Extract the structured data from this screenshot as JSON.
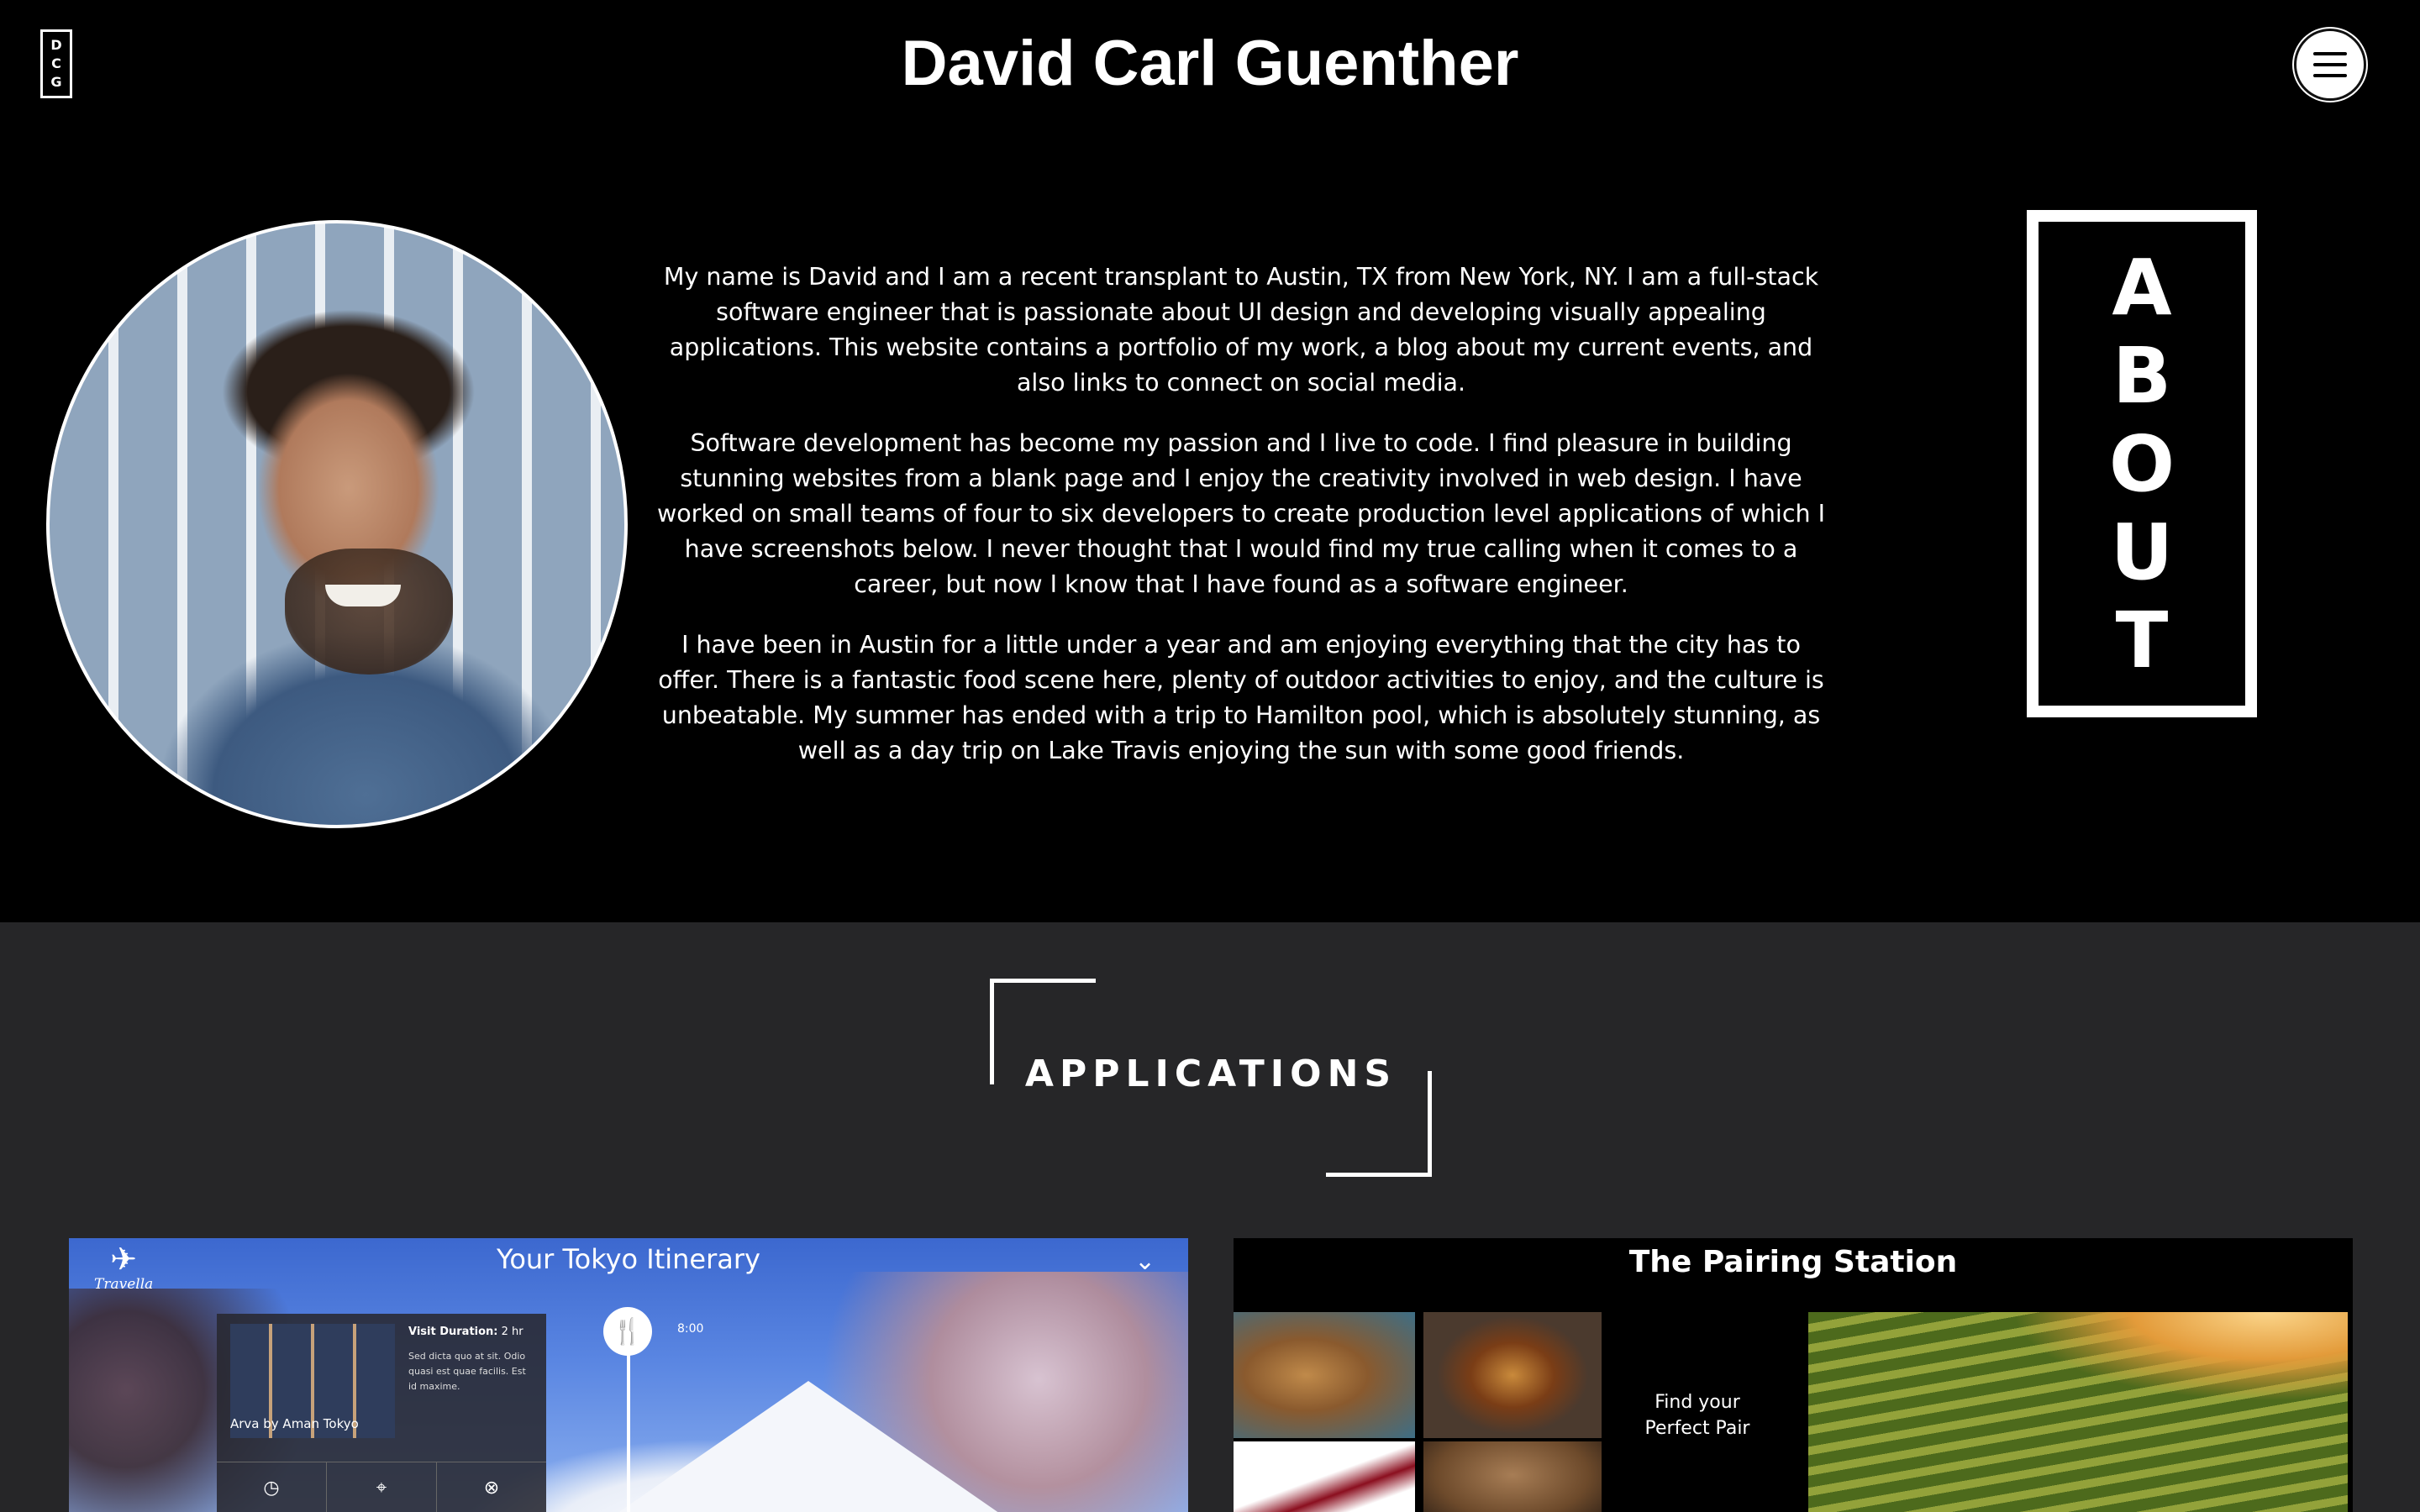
{
  "header": {
    "logo_letters": [
      "D",
      "C",
      "G"
    ],
    "title": "David Carl Guenther",
    "menu_icon": "hamburger-menu-icon"
  },
  "about": {
    "portrait_alt": "",
    "paragraphs": [
      "My name is David and I am a recent transplant to Austin, TX from New York, NY. I am a full-stack software engineer that is passionate about UI design and developing visually appealing applications. This website contains a portfolio of my work, a blog about my current events, and also links to connect on social media.",
      "Software development has become my passion and I live to code. I find pleasure in building stunning websites from a blank page and I enjoy the creativity involved in web design. I have worked on small teams of four to six developers to create production level applications of which I have screenshots below. I never thought that I would find my true calling when it comes to a career, but now I know that I have found as a software engineer.",
      "I have been in Austin for a little under a year and am enjoying everything that the city has to offer. There is a fantastic food scene here, plenty of outdoor activities to enjoy, and the culture is unbeatable. My summer has ended with a trip to Hamilton pool, which is absolutely stunning, as well as a day trip on Lake Travis enjoying the sun with some good friends."
    ],
    "badge_letters": [
      "A",
      "B",
      "O",
      "U",
      "T"
    ]
  },
  "applications": {
    "heading": "APPLICATIONS",
    "tokyo_card": {
      "brand": "Travella",
      "title": "Your Tokyo Itinerary",
      "time": "8:00",
      "popup": {
        "place": "Arva by Aman Tokyo",
        "duration_label": "Visit Duration:",
        "duration_value": "2 hr",
        "description": "Sed dicta quo at sit. Odio quasi est quae facilis. Est id maxime."
      }
    },
    "pairing_card": {
      "title": "The Pairing Station",
      "cta": "Find your Perfect Pair"
    }
  },
  "colors": {
    "background": "#000000",
    "apps_background": "#262628",
    "text": "#ffffff"
  }
}
